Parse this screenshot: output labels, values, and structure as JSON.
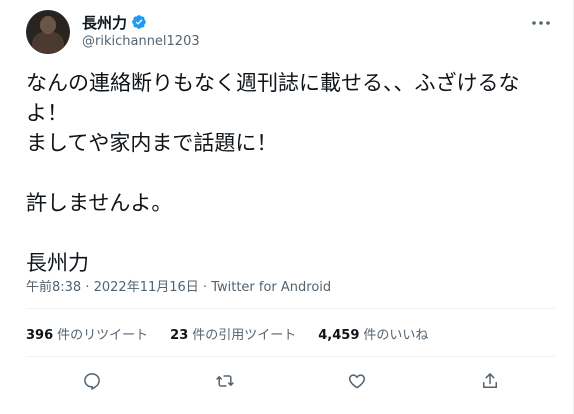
{
  "tweet": {
    "display_name": "長州力",
    "handle": "@rikichannel1203",
    "text": "なんの連絡断りもなく週刊誌に載せる、、ふざけるなよ！\nましてや家内まで話題に！\n\n許しませんよ。\n\n長州力",
    "timestamp": "午前8:38",
    "date": "2022年11月16日",
    "source": "Twitter for Android",
    "separator": " · "
  },
  "stats": {
    "retweets": {
      "count": "396",
      "label": "件のリツイート"
    },
    "quotes": {
      "count": "23",
      "label": "件の引用ツイート"
    },
    "likes": {
      "count": "4,459",
      "label": "件のいいね"
    }
  },
  "colors": {
    "verified": "#1d9bf0",
    "secondary": "#536471",
    "text": "#0f1419"
  },
  "icons": [
    "verified-badge-icon",
    "more-options-icon",
    "reply-icon",
    "retweet-icon",
    "like-icon",
    "share-icon"
  ]
}
